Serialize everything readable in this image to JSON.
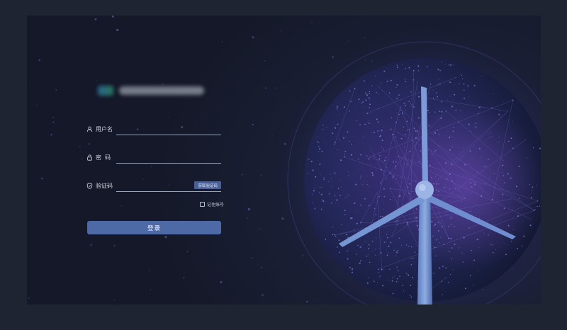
{
  "login": {
    "username_label": "用户名",
    "password_label": "密  码",
    "captcha_label": "验证码",
    "get_captcha_label": "获取验证码",
    "remember_label": "记住账号",
    "login_button": "登录",
    "username_value": "",
    "password_value": "",
    "captcha_value": ""
  },
  "icons": {
    "username": "user-icon",
    "password": "lock-icon",
    "captcha": "shield-icon"
  },
  "colors": {
    "background": "#1f2433",
    "accent": "#4d6aa6",
    "globe_glow": "#6b52c7",
    "turbine": "#6e8fcf"
  }
}
